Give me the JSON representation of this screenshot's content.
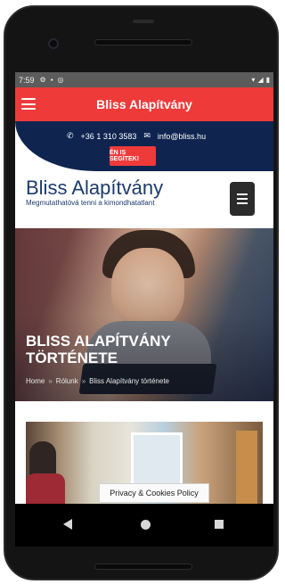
{
  "status": {
    "time": "7:59",
    "left_icons": [
      "gear-icon",
      "sim-icon",
      "sync-icon"
    ],
    "right_icons": [
      "wifi-icon",
      "signal-icon",
      "battery-icon"
    ]
  },
  "appbar": {
    "title": "Bliss Alapítvány"
  },
  "contact": {
    "phone": "+36 1 310 3583",
    "email": "info@bliss.hu",
    "cta_label": "ÉN IS SEGÍTEK!"
  },
  "brand": {
    "name": "Bliss Alapítvány",
    "tagline": "Megmutathatóvá tenni a kimondhatatlant"
  },
  "hero": {
    "headline_line1": "BLISS ALAPÍTVÁNY",
    "headline_line2": "TÖRTÉNETE",
    "breadcrumb": [
      "Home",
      "Rólunk",
      "Bliss Alapítvány története"
    ],
    "breadcrumb_separator": "»"
  },
  "privacy": {
    "label": "Privacy & Cookies Policy"
  },
  "colors": {
    "accent_red": "#ef3a3a",
    "navy": "#0f2550",
    "brand_blue": "#1c3a6e"
  }
}
